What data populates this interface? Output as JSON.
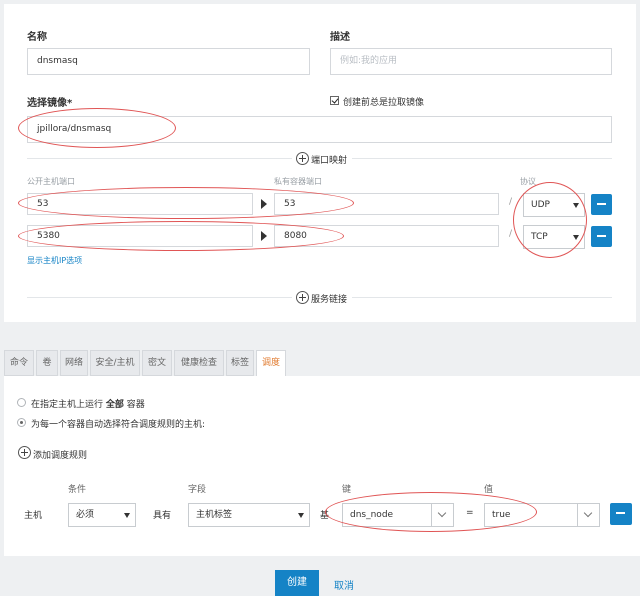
{
  "form": {
    "name_label": "名称",
    "name_value": "dnsmasq",
    "desc_label": "描述",
    "desc_placeholder": "例如:我的应用",
    "image_label": "选择镜像*",
    "image_value": "jpillora/dnsmasq",
    "pull_label": "创建前总是拉取镜像",
    "pull_checked": true
  },
  "ports": {
    "section_label": "端口映射",
    "public_header": "公开主机端口",
    "private_header": "私有容器端口",
    "protocol_header": "协议",
    "separator": "/",
    "rows": [
      {
        "public": "53",
        "private": "53",
        "protocol": "UDP"
      },
      {
        "public": "5380",
        "private": "8080",
        "protocol": "TCP"
      }
    ],
    "show_ip_link": "显示主机IP选项"
  },
  "links": {
    "section_label": "服务链接"
  },
  "tabs": [
    {
      "label": "命令"
    },
    {
      "label": "卷"
    },
    {
      "label": "网络"
    },
    {
      "label": "安全/主机"
    },
    {
      "label": "密文"
    },
    {
      "label": "健康检查"
    },
    {
      "label": "标签"
    },
    {
      "label": "调度",
      "active": true
    }
  ],
  "scheduling": {
    "option1_prefix": "在指定主机上运行",
    "option1_bold": "全部",
    "option1_suffix": "容器",
    "option2": "为每一个容器自动选择符合调度规则的主机:",
    "selected": 2,
    "add_rule_label": "添加调度规则",
    "col_condition": "条件",
    "col_field": "字段",
    "col_key": "键",
    "col_value": "值",
    "rule": {
      "row_label": "主机",
      "condition": "必须",
      "has_label": "具有",
      "field": "主机标签",
      "key_op": "基",
      "key": "dns_node",
      "equals": "=",
      "value": "true"
    }
  },
  "actions": {
    "create": "创建",
    "cancel": "取消"
  },
  "colors": {
    "primary": "#1583c6",
    "active_tab": "#e07a2e",
    "annotation": "#e05555"
  }
}
